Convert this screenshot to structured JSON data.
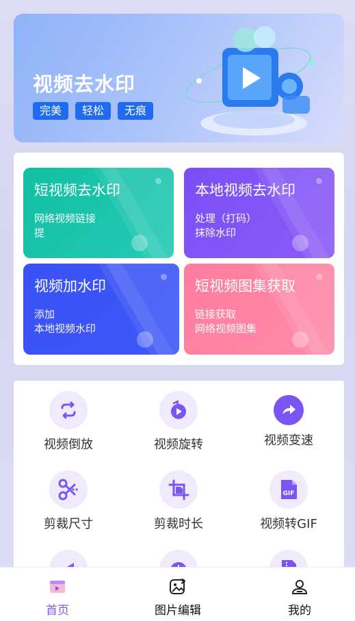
{
  "banner": {
    "title": "视频去水印",
    "tags": [
      "完美",
      "轻松",
      "无痕"
    ]
  },
  "tools": [
    {
      "title": "短视频去水印",
      "desc_line1": "网络视频链接",
      "desc_line2": "提"
    },
    {
      "title": "本地视频去水印",
      "desc_line1": "处理（打码）",
      "desc_line2": "抹除水印"
    },
    {
      "title": "视频加水印",
      "desc_line1": "添加",
      "desc_line2": "本地视频水印"
    },
    {
      "title": "短视频图集获取",
      "desc_line1": "链接获取",
      "desc_line2": "网络视频图集"
    }
  ],
  "grid": [
    {
      "label": "视频倒放",
      "icon": "reverse-arrows-icon"
    },
    {
      "label": "视频旋转",
      "icon": "rotate-play-icon"
    },
    {
      "label": "视频变速",
      "icon": "forward-share-icon"
    },
    {
      "label": "剪裁尺寸",
      "icon": "scissors-icon"
    },
    {
      "label": "剪裁时长",
      "icon": "crop-file-icon"
    },
    {
      "label": "视频转GIF",
      "icon": "gif-file-icon"
    }
  ],
  "nav": {
    "items": [
      {
        "label": "首页",
        "icon": "home-video-icon",
        "active": true
      },
      {
        "label": "图片编辑",
        "icon": "image-edit-icon",
        "active": false
      },
      {
        "label": "我的",
        "icon": "profile-icon",
        "active": false
      }
    ]
  },
  "colors": {
    "accent": "#7b55f2",
    "teal": "#1cc4ab",
    "purple": "#8052f6",
    "blue": "#3b54f5",
    "pink": "#ff84a4",
    "tag_blue": "#1e6bf0"
  }
}
